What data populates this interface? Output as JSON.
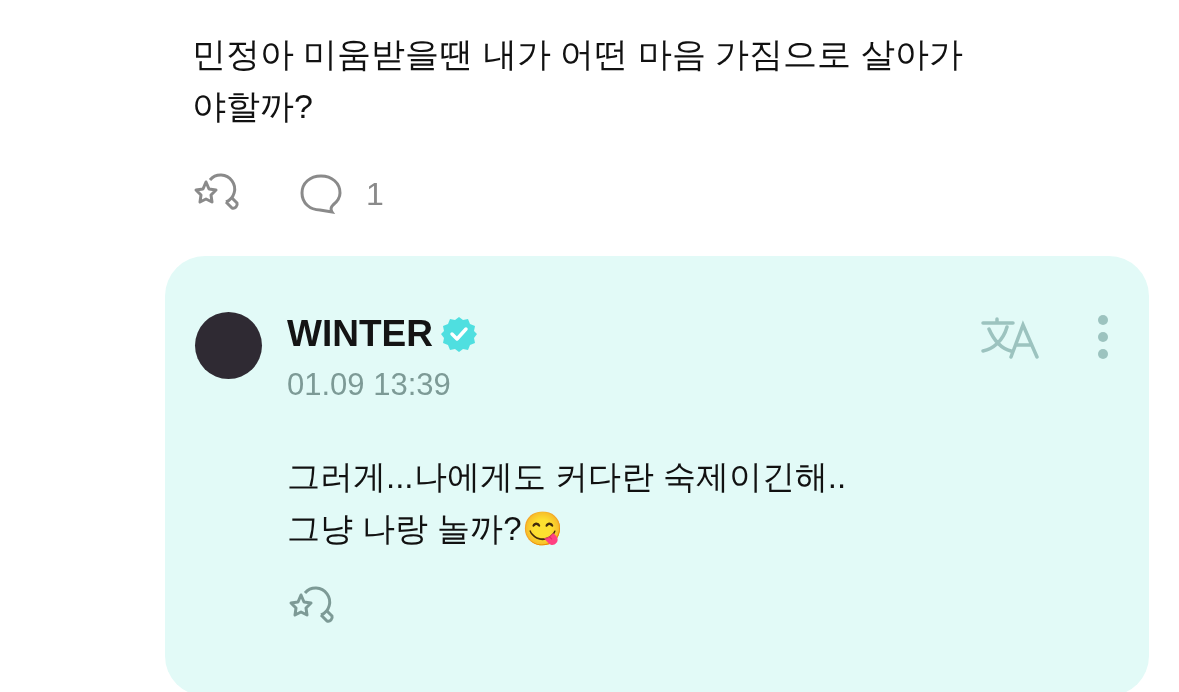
{
  "post": {
    "text_lines": [
      "민정아 미움받을땐 내가 어떤 마음 가짐으로 살아가",
      "야할까?"
    ],
    "comment_count": "1"
  },
  "reply": {
    "author": "WINTER",
    "verified": true,
    "time": "01.09 13:39",
    "text_lines": [
      "그러게...나에게도 커다란 숙제이긴해..",
      "그냥 나랑 놀까?😋"
    ]
  }
}
